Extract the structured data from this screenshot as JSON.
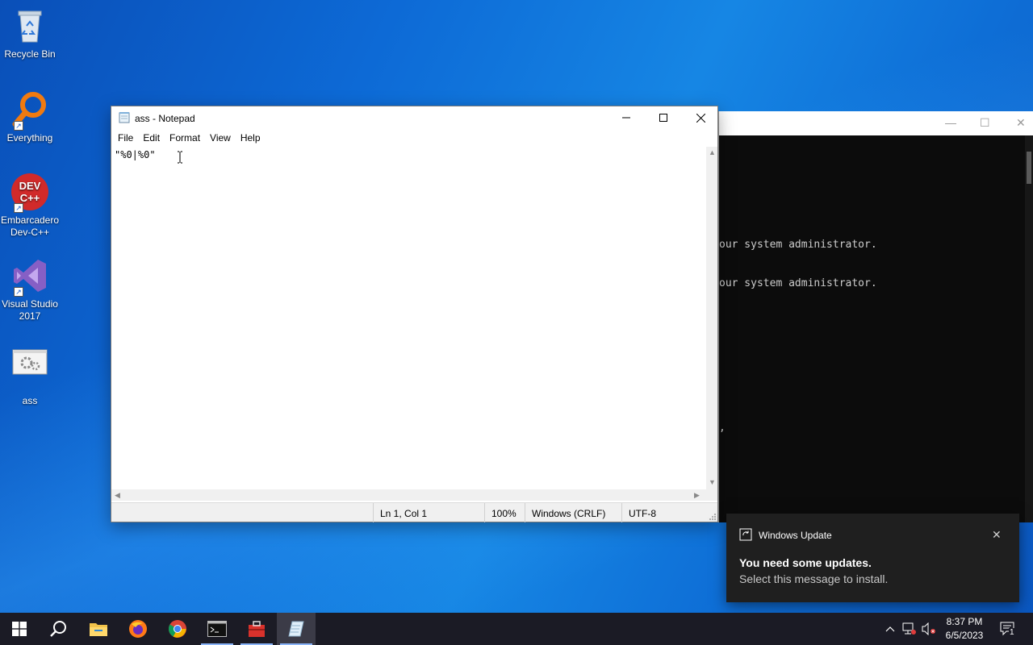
{
  "desktop": {
    "icons": [
      {
        "label": "Recycle Bin",
        "icon": "recycle-bin-icon"
      },
      {
        "label": "Everything",
        "icon": "everything-search-icon"
      },
      {
        "label": "Embarcadero Dev-C++",
        "icon": "devcpp-icon",
        "badge": "DEV C++"
      },
      {
        "label": "Visual Studio 2017",
        "icon": "visual-studio-icon"
      },
      {
        "label": "ass",
        "icon": "batch-file-icon"
      }
    ]
  },
  "console": {
    "lines": [
      "our system administrator.",
      "our system administrator.",
      ","
    ]
  },
  "notepad": {
    "title": "ass - Notepad",
    "menu": [
      "File",
      "Edit",
      "Format",
      "View",
      "Help"
    ],
    "content": "\"%0|%0\"",
    "status": {
      "position": "Ln 1, Col 1",
      "zoom": "100%",
      "line_ending": "Windows (CRLF)",
      "encoding": "UTF-8"
    }
  },
  "toast": {
    "app": "Windows Update",
    "heading": "You need some updates.",
    "body": "Select this message to install."
  },
  "taskbar": {
    "items": [
      "start-button",
      "search-button",
      "file-explorer",
      "firefox",
      "chrome",
      "command-prompt",
      "toolbox-app",
      "notepad"
    ],
    "time": "8:37 PM",
    "date": "6/5/2023",
    "notification_count": "1"
  },
  "colors": {
    "taskbar": "#1b1b25",
    "toast": "#1f1f1f",
    "desktop_accent": "#0d6ad6"
  }
}
